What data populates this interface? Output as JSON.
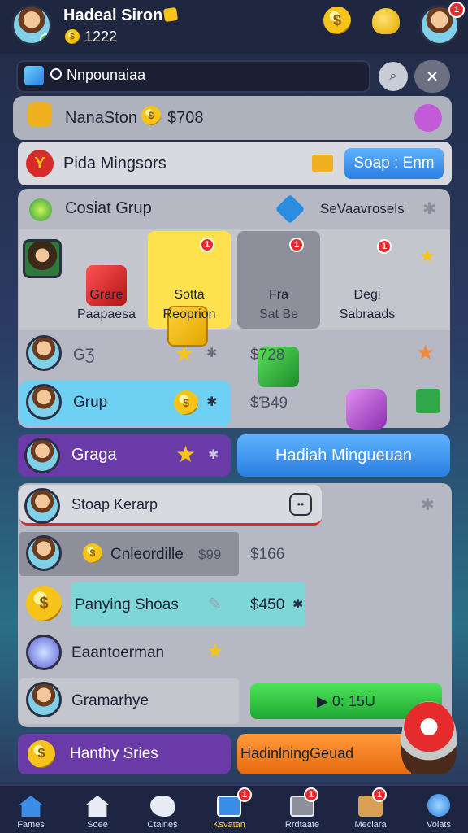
{
  "header": {
    "user_name": "Hadeal Siron",
    "coins": "1222",
    "notif_count": "1"
  },
  "search": {
    "query": "Nnpounaiaa"
  },
  "store_row": {
    "title": "NanaSton",
    "price": "$708"
  },
  "promo_row": {
    "title": "Pida Mingsors",
    "button": "Soap : Enm"
  },
  "group": {
    "title": "Cosiat Grup",
    "right_label": "SeVaavrosels",
    "cards": [
      {
        "line1": "Grare",
        "line2": "Paapaesa"
      },
      {
        "line1": "Sotta",
        "line2": "Reoprion",
        "badge": "1"
      },
      {
        "line1": "Fra",
        "line2": "Sat Be",
        "badge": "1"
      },
      {
        "line1": "Degi",
        "line2": "Sabraads",
        "badge": "1"
      }
    ],
    "rows": [
      {
        "label": "GƷ",
        "price": "$728"
      },
      {
        "label": "Grup",
        "price": "$Ɓ49"
      }
    ]
  },
  "graga": {
    "label": "Graga",
    "button": "Hadiah Mingueuan"
  },
  "snap": {
    "title": "Stoap Kerarp",
    "rows": [
      {
        "label": "Cnleordille",
        "tag": "$99",
        "price": "$166"
      },
      {
        "label": "Panying Shoas",
        "price": "$450"
      },
      {
        "label": "Eaantoerman"
      },
      {
        "label": "Gramarhye",
        "button": "▶ 0: 15U"
      }
    ]
  },
  "bottom": {
    "left": "Hanthy Sries",
    "right": "HadinlningGeuad"
  },
  "tabs": [
    {
      "label": "Fames"
    },
    {
      "label": "Soee"
    },
    {
      "label": "Ctalnes"
    },
    {
      "label": "Ksvatan",
      "badge": "1"
    },
    {
      "label": "Rrdtaate",
      "badge": "1"
    },
    {
      "label": "Meciara",
      "badge": "1"
    },
    {
      "label": "Voiats"
    }
  ],
  "colors": {
    "accent_blue": "#2b7fe0",
    "accent_yellow": "#ffe24d",
    "accent_green": "#27c33d",
    "accent_purple": "#6a3aa8",
    "accent_orange": "#f07a1a"
  }
}
